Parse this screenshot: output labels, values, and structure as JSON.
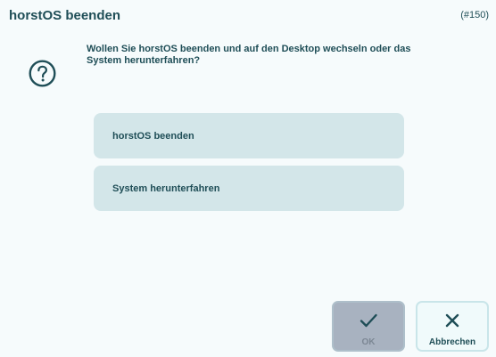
{
  "dialog": {
    "title": "horstOS beenden",
    "id_label": "(#150)",
    "message": "Wollen Sie horstOS beenden und auf den Desktop wechseln oder das System herunterfahren?",
    "icon": "question-icon"
  },
  "options": [
    {
      "label": "horstOS beenden"
    },
    {
      "label": "System herunterfahren"
    }
  ],
  "buttons": {
    "ok": {
      "label": "OK",
      "icon": "checkmark-icon",
      "state": "disabled"
    },
    "cancel": {
      "label": "Abbrechen",
      "icon": "close-icon"
    }
  },
  "colors": {
    "background": "#f6fbfc",
    "text": "#1f4e57",
    "option_bg": "#d3e6e9",
    "ok_disabled_bg": "#a8b2c0",
    "cancel_bg": "#f0fafb"
  }
}
